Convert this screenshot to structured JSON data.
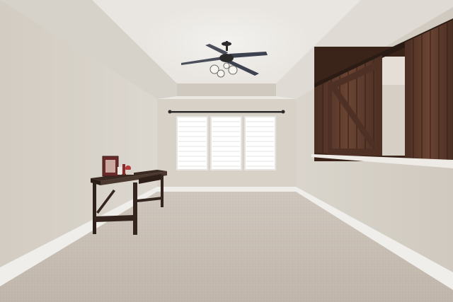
{
  "scene": {
    "description_colors": {
      "wall": "#d9d4cb",
      "wall_shadow": "#c9c3b9",
      "ceiling": "#e6e2dc",
      "carpet": "#c6bcb2",
      "baseboard": "#f2f0ec",
      "barn_wood": "#5a3a2c",
      "barn_wood_dark": "#3e261c",
      "table_wood": "#3a2a22",
      "window_blind": "#f4f4f2"
    },
    "icons": [
      "ceiling-fan-icon"
    ]
  }
}
